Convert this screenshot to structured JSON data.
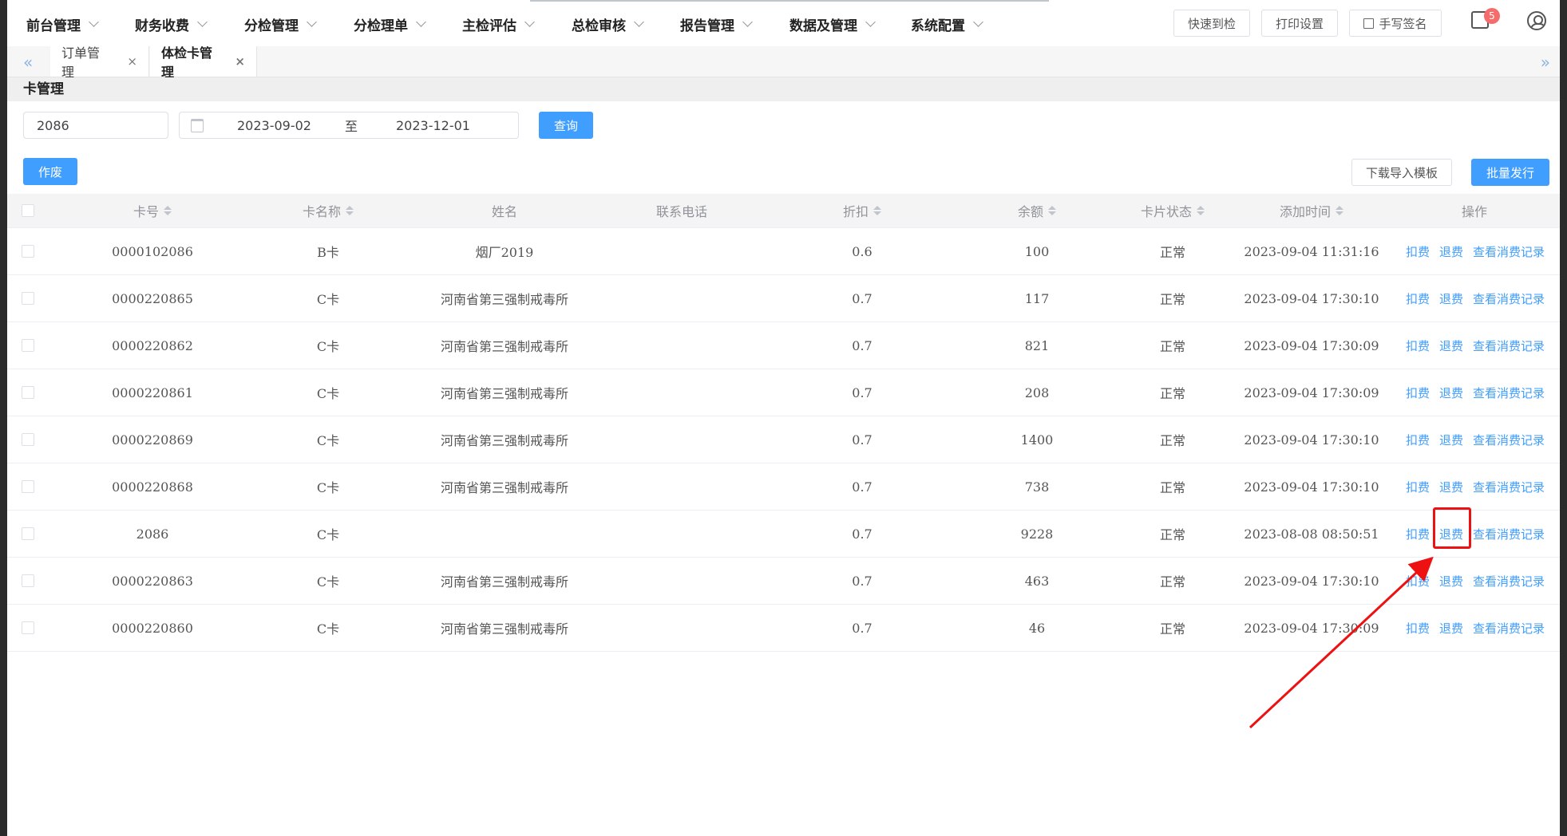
{
  "nav": {
    "items": [
      "前台管理",
      "财务收费",
      "分检管理",
      "分检理单",
      "主检评估",
      "总检审核",
      "报告管理",
      "数据及管理",
      "系统配置"
    ],
    "buttons": {
      "quick_checkin": "快速到检",
      "print_settings": "打印设置",
      "handwritten_sign": "手写签名"
    },
    "notification_count": "5"
  },
  "tabs": {
    "left_arrow": "«",
    "right_arrow": "»",
    "items": [
      {
        "label": "订单管理",
        "close": "×"
      },
      {
        "label": "体检卡管理",
        "close": "×"
      }
    ]
  },
  "section_title": "卡管理",
  "filters": {
    "card_no": "2086",
    "date_start": "2023-09-02",
    "date_separator": "至",
    "date_end": "2023-12-01",
    "query_label": "查询"
  },
  "actions": {
    "void_label": "作废",
    "download_template_label": "下载导入模板",
    "batch_issue_label": "批量发行"
  },
  "table": {
    "headers": {
      "card_no": "卡号",
      "card_name": "卡名称",
      "name": "姓名",
      "phone": "联系电话",
      "discount": "折扣",
      "balance": "余额",
      "status": "卡片状态",
      "added_time": "添加时间",
      "ops": "操作"
    },
    "op_labels": {
      "deduct": "扣费",
      "refund": "退费",
      "history": "查看消费记录"
    },
    "rows": [
      {
        "card_no": "0000102086",
        "card_name": "B卡",
        "name": "烟厂2019",
        "phone": "",
        "discount": "0.6",
        "balance": "100",
        "status": "正常",
        "added_time": "2023-09-04 11:31:16"
      },
      {
        "card_no": "0000220865",
        "card_name": "C卡",
        "name": "河南省第三强制戒毒所",
        "phone": "",
        "discount": "0.7",
        "balance": "117",
        "status": "正常",
        "added_time": "2023-09-04 17:30:10"
      },
      {
        "card_no": "0000220862",
        "card_name": "C卡",
        "name": "河南省第三强制戒毒所",
        "phone": "",
        "discount": "0.7",
        "balance": "821",
        "status": "正常",
        "added_time": "2023-09-04 17:30:09"
      },
      {
        "card_no": "0000220861",
        "card_name": "C卡",
        "name": "河南省第三强制戒毒所",
        "phone": "",
        "discount": "0.7",
        "balance": "208",
        "status": "正常",
        "added_time": "2023-09-04 17:30:09"
      },
      {
        "card_no": "0000220869",
        "card_name": "C卡",
        "name": "河南省第三强制戒毒所",
        "phone": "",
        "discount": "0.7",
        "balance": "1400",
        "status": "正常",
        "added_time": "2023-09-04 17:30:10"
      },
      {
        "card_no": "0000220868",
        "card_name": "C卡",
        "name": "河南省第三强制戒毒所",
        "phone": "",
        "discount": "0.7",
        "balance": "738",
        "status": "正常",
        "added_time": "2023-09-04 17:30:10"
      },
      {
        "card_no": "2086",
        "card_name": "C卡",
        "name": "",
        "phone": "",
        "discount": "0.7",
        "balance": "9228",
        "status": "正常",
        "added_time": "2023-08-08 08:50:51"
      },
      {
        "card_no": "0000220863",
        "card_name": "C卡",
        "name": "河南省第三强制戒毒所",
        "phone": "",
        "discount": "0.7",
        "balance": "463",
        "status": "正常",
        "added_time": "2023-09-04 17:30:10"
      },
      {
        "card_no": "0000220860",
        "card_name": "C卡",
        "name": "河南省第三强制戒毒所",
        "phone": "",
        "discount": "0.7",
        "balance": "46",
        "status": "正常",
        "added_time": "2023-09-04 17:30:09"
      }
    ]
  },
  "annotation": {
    "color": "#ee1111"
  },
  "colors": {
    "primary": "#409eff",
    "badge": "#f56c6c"
  }
}
